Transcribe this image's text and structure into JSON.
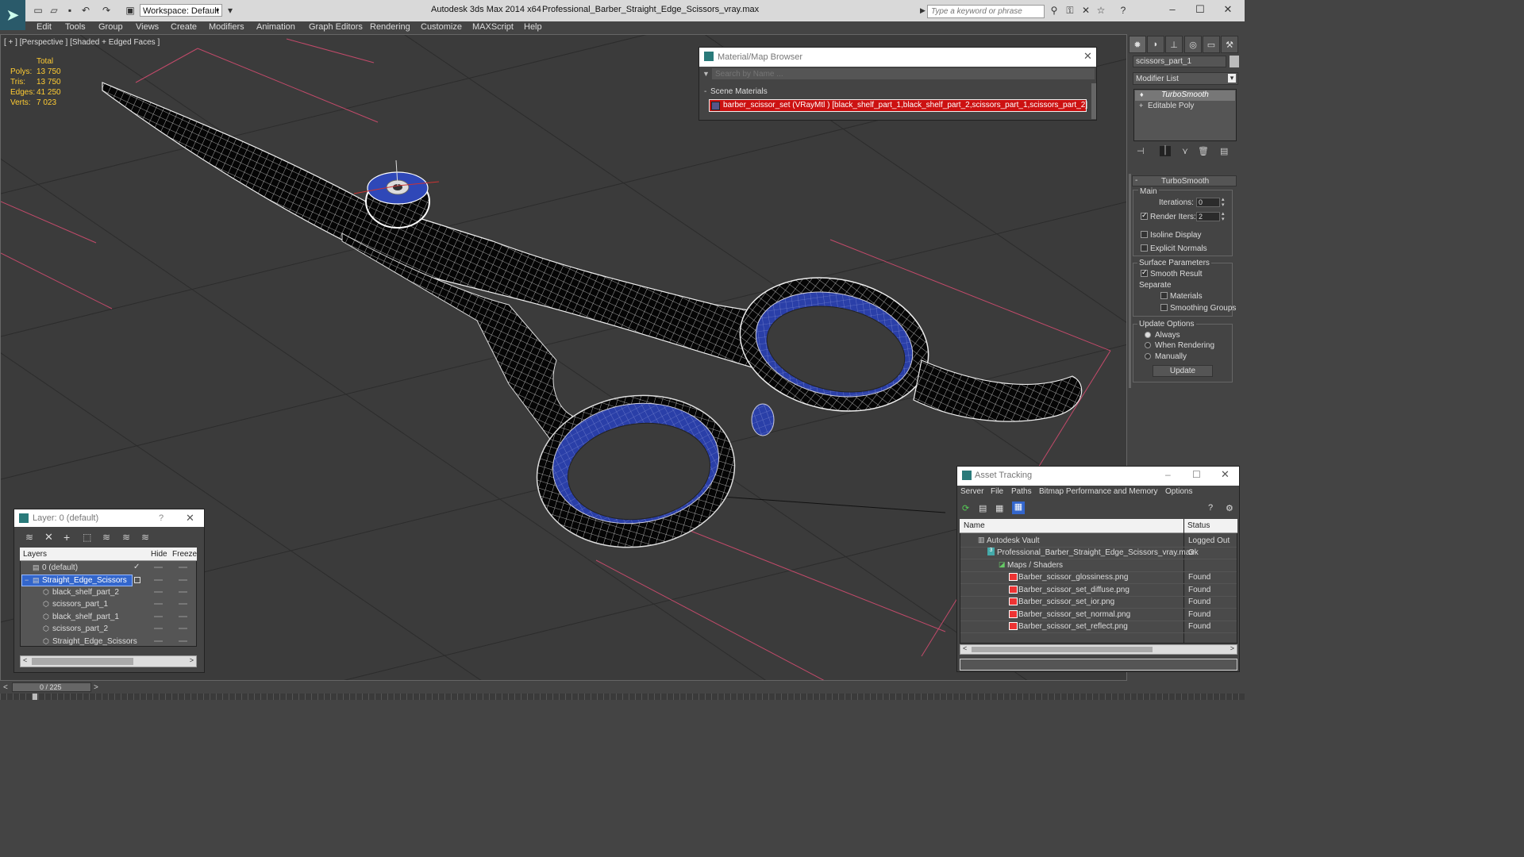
{
  "titlebar": {
    "workspace_label": "Workspace: Default",
    "app_title": "Autodesk 3ds Max  2014 x64",
    "file_title": "Professional_Barber_Straight_Edge_Scissors_vray.max",
    "search_placeholder": "Type a keyword or phrase"
  },
  "menu": [
    "Edit",
    "Tools",
    "Group",
    "Views",
    "Create",
    "Modifiers",
    "Animation",
    "Graph Editors",
    "Rendering",
    "Customize",
    "MAXScript",
    "Help"
  ],
  "viewport": {
    "label": "[ + ] [Perspective ] [Shaded + Edged Faces ]",
    "stats": {
      "header": "Total",
      "rows": [
        {
          "label": "Polys:",
          "value": "13 750"
        },
        {
          "label": "Tris:",
          "value": "13 750"
        },
        {
          "label": "Edges:",
          "value": "41 250"
        },
        {
          "label": "Verts:",
          "value": "7 023"
        }
      ]
    }
  },
  "material_browser": {
    "title": "Material/Map Browser",
    "search_placeholder": "Search by Name ...",
    "section": "Scene Materials",
    "item": "barber_scissor_set (VRayMtl ) [black_shelf_part_1,black_shelf_part_2,scissors_part_1,scissors_part_2]"
  },
  "command_panel": {
    "object_name": "scissors_part_1",
    "modifier_list": "Modifier List",
    "stack": [
      "TurboSmooth",
      "Editable Poly"
    ],
    "rollout_title": "TurboSmooth",
    "main_label": "Main",
    "iterations_label": "Iterations:",
    "iterations_value": "0",
    "render_iters_label": "Render Iters:",
    "render_iters_value": "2",
    "isoline": "Isoline Display",
    "explicit": "Explicit Normals",
    "surface_params": "Surface Parameters",
    "smooth_result": "Smooth Result",
    "separate": "Separate",
    "materials": "Materials",
    "smoothing_groups": "Smoothing Groups",
    "update_options": "Update Options",
    "always": "Always",
    "when_rendering": "When Rendering",
    "manually": "Manually",
    "update_button": "Update"
  },
  "layer_dialog": {
    "title": "Layer: 0 (default)",
    "help": "?",
    "col_layers": "Layers",
    "col_hide": "Hide",
    "col_freeze": "Freeze",
    "rows": [
      {
        "name": "0 (default)"
      },
      {
        "name": "Straight_Edge_Scissors"
      },
      {
        "name": "black_shelf_part_2"
      },
      {
        "name": "scissors_part_1"
      },
      {
        "name": "black_shelf_part_1"
      },
      {
        "name": "scissors_part_2"
      },
      {
        "name": "Straight_Edge_Scissors"
      }
    ]
  },
  "asset_tracking": {
    "title": "Asset Tracking",
    "menu": [
      "Server",
      "File",
      "Paths",
      "Bitmap Performance and Memory",
      "Options"
    ],
    "col_name": "Name",
    "col_status": "Status",
    "rows": [
      {
        "name": "Autodesk Vault",
        "status": "Logged Out ..."
      },
      {
        "name": "Professional_Barber_Straight_Edge_Scissors_vray.max",
        "status": "Ok"
      },
      {
        "name": "Maps / Shaders",
        "status": ""
      },
      {
        "name": "Barber_scissor_glossiness.png",
        "status": "Found"
      },
      {
        "name": "Barber_scissor_set_diffuse.png",
        "status": "Found"
      },
      {
        "name": "Barber_scissor_set_ior.png",
        "status": "Found"
      },
      {
        "name": "Barber_scissor_set_normal.png",
        "status": "Found"
      },
      {
        "name": "Barber_scissor_set_reflect.png",
        "status": "Found"
      }
    ]
  },
  "timeline": {
    "frame": "0 / 225"
  },
  "colors": {
    "accent": "#3366cc",
    "wire_blue": "#2a3fa8",
    "stats": "#ffcc33",
    "selected_red": "#cc1111"
  }
}
